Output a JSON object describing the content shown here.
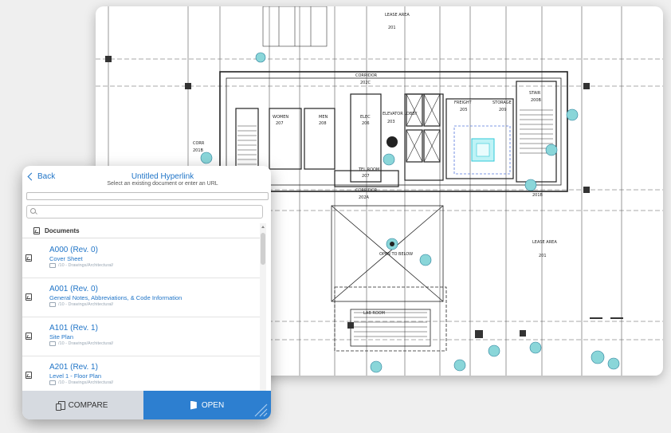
{
  "plan": {
    "labels": {
      "lease_area_top": "LEASE AREA",
      "lease_area_top_num": "201",
      "corridor_top": "CORRIDOR",
      "corridor_top_num": "202C",
      "freight": "FREIGHT",
      "freight_num": "205",
      "storage": "STORAGE",
      "storage_num": "209",
      "women": "WOMEN",
      "women_num": "207",
      "men": "MEN",
      "men_num": "208",
      "elec": "ELEC",
      "elec_num": "206",
      "elevator_lobby": "ELEVATOR LOBBY",
      "elevator_lobby_num": "203",
      "stair": "STAIR",
      "stair_num": "200B",
      "tel_room": "TEL ROOM",
      "tel_room_num": "207",
      "corridor_bottom": "CORRIDOR",
      "corridor_bottom_num": "202A",
      "lease_area_right": "LEASE AREA",
      "lease_area_right_num": "201",
      "stair_right_num": "201B",
      "corr": "CORR",
      "corr_num": "201B",
      "open_to_below": "OPEN TO BELOW",
      "lab_room": "LAB ROOM"
    }
  },
  "dialog": {
    "back_label": "Back",
    "title": "Untitled Hyperlink",
    "subtitle": "Select an existing document or enter an URL",
    "url_value": "",
    "search_placeholder": "",
    "section_label": "Documents",
    "documents": [
      {
        "name": "A000 (Rev. 0)",
        "desc": "Cover Sheet",
        "path": "/10 - Drawings/Architectural/"
      },
      {
        "name": "A001 (Rev. 0)",
        "desc": "General Notes, Abbreviations, & Code Information",
        "path": "/10 - Drawings/Architectural/"
      },
      {
        "name": "A101 (Rev. 1)",
        "desc": "Site Plan",
        "path": "/10 - Drawings/Architectural/"
      },
      {
        "name": "A201 (Rev. 1)",
        "desc": "Level 1 - Floor Plan",
        "path": "/10 - Drawings/Architectural/"
      }
    ],
    "compare_label": "COMPARE",
    "open_label": "OPEN",
    "colors": {
      "accent": "#2d7fd0",
      "link": "#1f74c7",
      "compare_bg": "#d6dae0"
    }
  }
}
